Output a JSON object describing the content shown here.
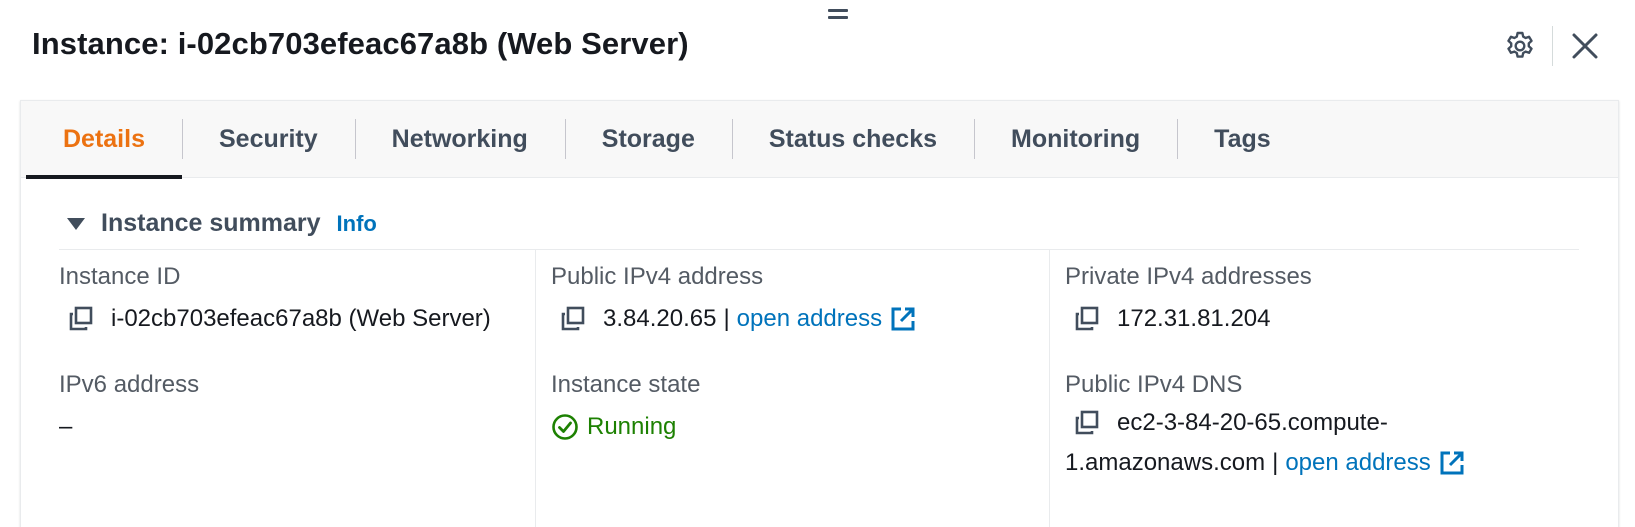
{
  "header": {
    "title": "Instance: i-02cb703efeac67a8b (Web Server)",
    "settings_icon": "gear-icon",
    "close_icon": "close-icon"
  },
  "tabs": [
    {
      "label": "Details",
      "active": true
    },
    {
      "label": "Security",
      "active": false
    },
    {
      "label": "Networking",
      "active": false
    },
    {
      "label": "Storage",
      "active": false
    },
    {
      "label": "Status checks",
      "active": false
    },
    {
      "label": "Monitoring",
      "active": false
    },
    {
      "label": "Tags",
      "active": false
    }
  ],
  "summary": {
    "title": "Instance summary",
    "info_label": "Info",
    "instance_id": {
      "label": "Instance ID",
      "value": "i-02cb703efeac67a8b (Web Server)"
    },
    "public_ipv4": {
      "label": "Public IPv4 address",
      "value": "3.84.20.65",
      "link": "open address"
    },
    "private_ipv4": {
      "label": "Private IPv4 addresses",
      "value": "172.31.81.204"
    },
    "ipv6": {
      "label": "IPv6 address",
      "value": "–"
    },
    "instance_state": {
      "label": "Instance state",
      "value": "Running"
    },
    "public_dns": {
      "label": "Public IPv4 DNS",
      "value_line1": "ec2-3-84-20-65.compute-",
      "value_line2": "1.amazonaws.com",
      "link": "open address"
    }
  },
  "colors": {
    "accent_active_tab": "#ec7211",
    "link": "#0073bb",
    "status_success": "#1d8102",
    "text_primary": "#16191f",
    "text_secondary": "#545b64"
  }
}
